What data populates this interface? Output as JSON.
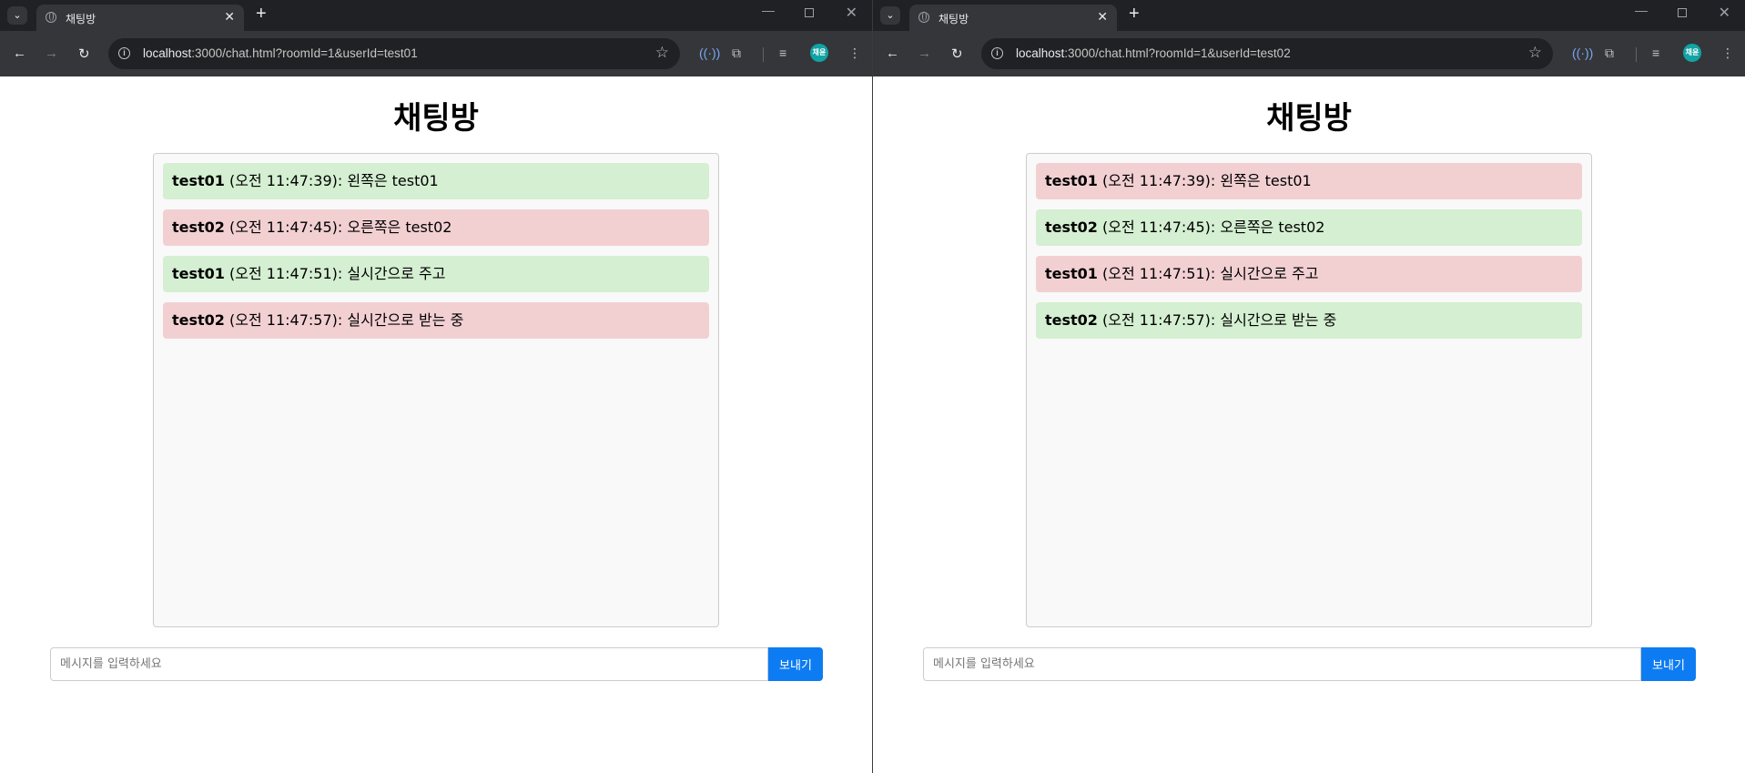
{
  "windows": [
    {
      "tab_title": "채팅방",
      "url_host": "localhost",
      "url_rest": ":3000/chat.html?roomId=1&userId=test01",
      "avatar_label": "채윤",
      "page_title": "채팅방",
      "messages": [
        {
          "user": "test01",
          "meta": " (오전 11:47:39): ",
          "text": "왼쪽은 test01",
          "mine": true
        },
        {
          "user": "test02",
          "meta": " (오전 11:47:45): ",
          "text": "오른쪽은 test02",
          "mine": false
        },
        {
          "user": "test01",
          "meta": " (오전 11:47:51): ",
          "text": "실시간으로 주고",
          "mine": true
        },
        {
          "user": "test02",
          "meta": " (오전 11:47:57): ",
          "text": "실시간으로 받는 중",
          "mine": false
        }
      ],
      "input_placeholder": "메시지를 입력하세요",
      "send_label": "보내기"
    },
    {
      "tab_title": "채팅방",
      "url_host": "localhost",
      "url_rest": ":3000/chat.html?roomId=1&userId=test02",
      "avatar_label": "채윤",
      "page_title": "채팅방",
      "messages": [
        {
          "user": "test01",
          "meta": " (오전 11:47:39): ",
          "text": "왼쪽은 test01",
          "mine": false
        },
        {
          "user": "test02",
          "meta": " (오전 11:47:45): ",
          "text": "오른쪽은 test02",
          "mine": true
        },
        {
          "user": "test01",
          "meta": " (오전 11:47:51): ",
          "text": "실시간으로 주고",
          "mine": false
        },
        {
          "user": "test02",
          "meta": " (오전 11:47:57): ",
          "text": "실시간으로 받는 중",
          "mine": true
        }
      ],
      "input_placeholder": "메시지를 입력하세요",
      "send_label": "보내기"
    }
  ],
  "colors": {
    "mine_bg": "#d4efd1",
    "other_bg": "#f2d0d2",
    "send_button": "#0d7cf2"
  },
  "icons": {
    "tab_menu": "chevron-down-icon",
    "favicon": "globe-icon",
    "tab_close": "close-icon",
    "new_tab": "plus-icon",
    "back": "arrow-left-icon",
    "forward": "arrow-right-icon",
    "reload": "reload-icon",
    "site_info": "info-icon",
    "bookmark": "star-icon",
    "read_aloud": "read-aloud-icon",
    "extensions": "puzzle-icon",
    "media": "media-queue-icon",
    "menu": "kebab-menu-icon"
  }
}
